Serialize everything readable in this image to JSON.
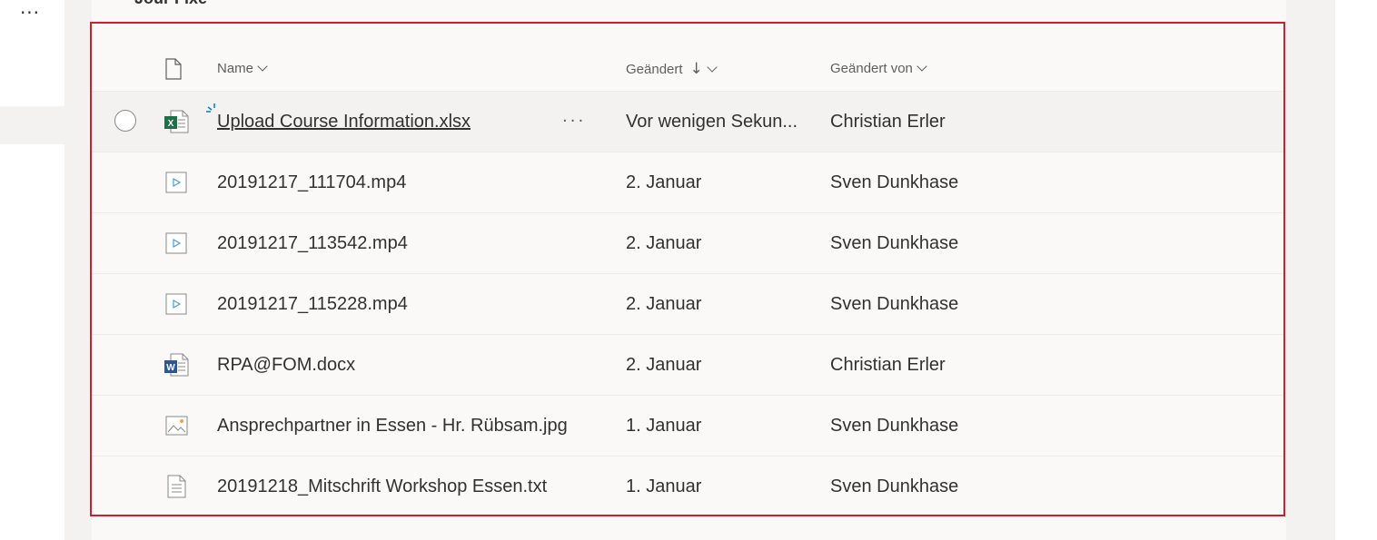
{
  "left_rail": {
    "more_label": "···"
  },
  "library": {
    "title": "Jour Fixe"
  },
  "columns": {
    "name": "Name",
    "modified": "Geändert",
    "modified_sort": "↓",
    "modified_by": "Geändert von"
  },
  "files": [
    {
      "name": "Upload Course Information.xlsx",
      "icon": "excel-icon",
      "modified": "Vor wenigen Sekun...",
      "modified_by": "Christian Erler",
      "more": "···"
    },
    {
      "name": "20191217_111704.mp4",
      "icon": "video-icon",
      "modified": "2. Januar",
      "modified_by": "Sven Dunkhase"
    },
    {
      "name": "20191217_113542.mp4",
      "icon": "video-icon",
      "modified": "2. Januar",
      "modified_by": "Sven Dunkhase"
    },
    {
      "name": "20191217_115228.mp4",
      "icon": "video-icon",
      "modified": "2. Januar",
      "modified_by": "Sven Dunkhase"
    },
    {
      "name": "RPA@FOM.docx",
      "icon": "word-icon",
      "modified": "2. Januar",
      "modified_by": "Christian Erler"
    },
    {
      "name": "Ansprechpartner in Essen - Hr. Rübsam.jpg",
      "icon": "image-icon",
      "modified": "1. Januar",
      "modified_by": "Sven Dunkhase"
    },
    {
      "name": "20191218_Mitschrift Workshop Essen.txt",
      "icon": "text-file-icon",
      "modified": "1. Januar",
      "modified_by": "Sven Dunkhase"
    }
  ],
  "colors": {
    "highlight_border": "#d01e2f",
    "excel_green": "#1e7145",
    "word_blue": "#2b579a",
    "video_blue": "#4a9ed8"
  }
}
